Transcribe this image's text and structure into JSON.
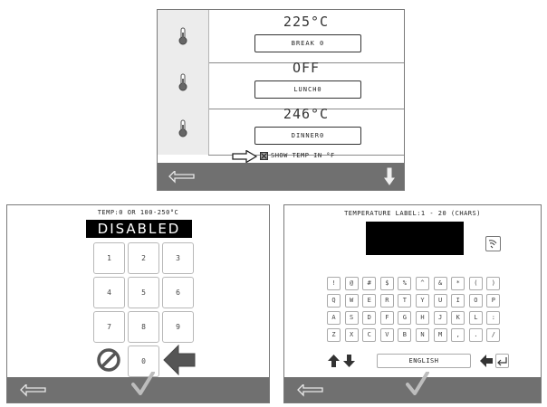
{
  "top": {
    "rows": [
      {
        "temp": "225°C",
        "label": "BREAK 0"
      },
      {
        "temp": "OFF",
        "label": "LUNCH0"
      },
      {
        "temp": "246°C",
        "label": "DINNER0"
      }
    ],
    "show_temp_label": "SHOW TEMP IN °F"
  },
  "numpad": {
    "header": "TEMP:0 OR 100-250°C",
    "display": "DISABLED",
    "keys": [
      "1",
      "2",
      "3",
      "4",
      "5",
      "6",
      "7",
      "8",
      "9"
    ],
    "zero": "0"
  },
  "keyboard": {
    "header": "TEMPERATURE LABEL:1 - 20 (CHARS)",
    "rows": [
      [
        "!",
        "@",
        "#",
        "$",
        "%",
        "^",
        "&",
        "*",
        "(",
        ")"
      ],
      [
        "Q",
        "W",
        "E",
        "R",
        "T",
        "Y",
        "U",
        "I",
        "O",
        "P"
      ],
      [
        "A",
        "S",
        "D",
        "F",
        "G",
        "H",
        "J",
        "K",
        "L",
        ":"
      ],
      [
        "Z",
        "X",
        "C",
        "V",
        "B",
        "N",
        "M",
        ",",
        ".",
        "/"
      ]
    ],
    "language": "ENGLISH"
  },
  "colors": {
    "bar": "#707070",
    "cell": "#ececec",
    "screen": "#000000"
  },
  "icons": [
    "thermometer-icon",
    "back-arrow-icon",
    "down-arrow-icon",
    "checkmark-icon",
    "cancel-icon",
    "backspace-arrow-icon",
    "wireless-icon",
    "shift-up-icon",
    "shift-down-icon",
    "enter-icon",
    "pointer-arrow-icon"
  ]
}
